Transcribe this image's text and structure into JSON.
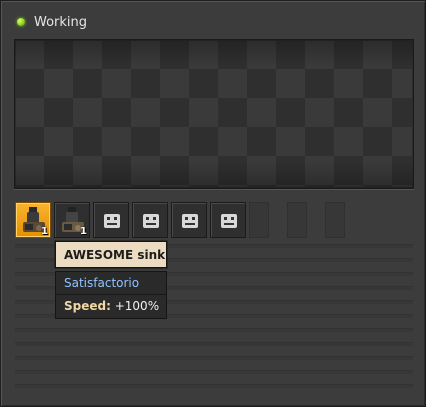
{
  "status": {
    "text": "Working",
    "color": "#8fd41e"
  },
  "slots": {
    "items": [
      {
        "name": "module",
        "count": "1",
        "state": "selected"
      },
      {
        "name": "module",
        "count": "1",
        "state": "filled"
      },
      {
        "name": "empty",
        "count": "",
        "state": "empty"
      },
      {
        "name": "empty",
        "count": "",
        "state": "empty"
      },
      {
        "name": "empty",
        "count": "",
        "state": "empty"
      },
      {
        "name": "empty",
        "count": "",
        "state": "empty"
      }
    ]
  },
  "tooltip": {
    "title": "AWESOME sink",
    "mod_name": "Satisfactorio",
    "speed_label": "Speed:",
    "speed_value": "+100%"
  }
}
